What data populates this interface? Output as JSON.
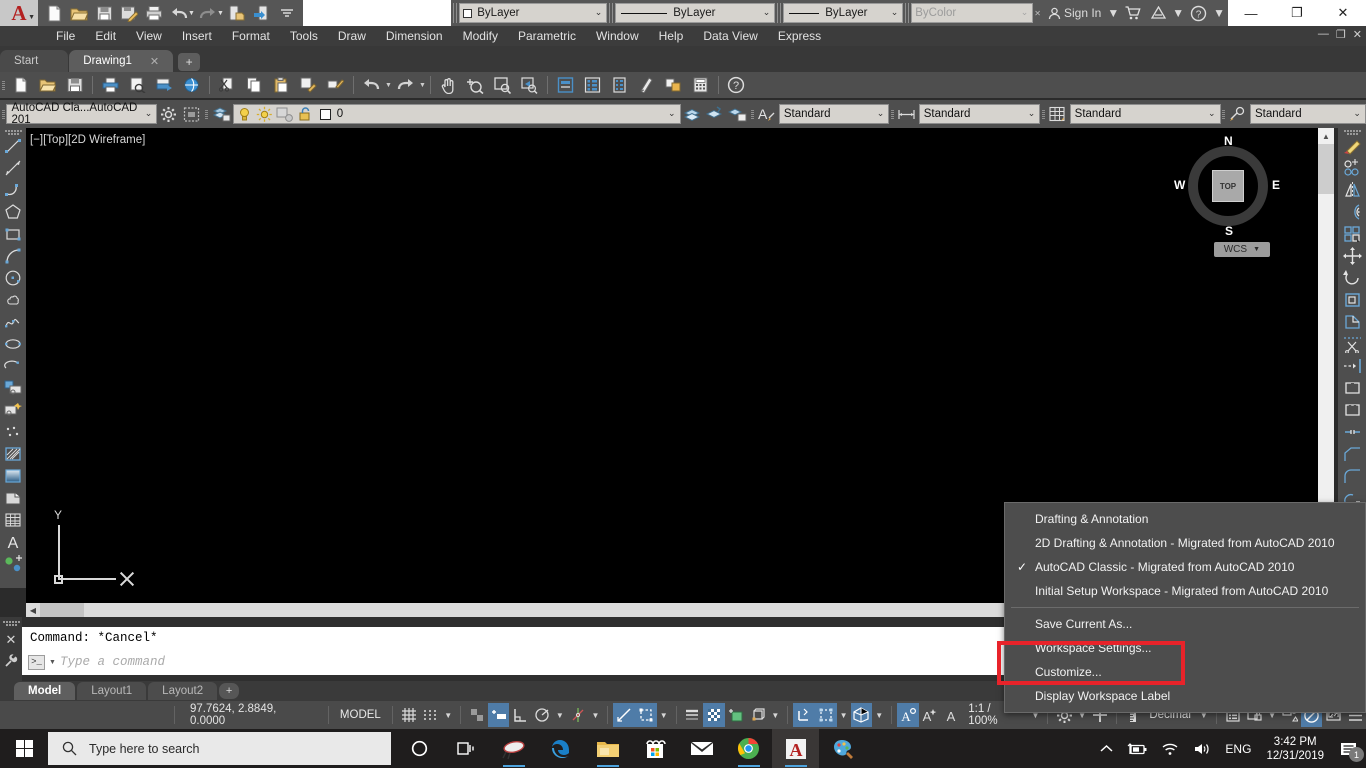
{
  "titlebar": {
    "app_name": "AutoCAD",
    "quick_access": [
      {
        "name": "new-file",
        "label": "New"
      },
      {
        "name": "open-file",
        "label": "Open"
      },
      {
        "name": "save-file",
        "label": "Save"
      },
      {
        "name": "save-as",
        "label": "Save As"
      },
      {
        "name": "plot",
        "label": "Plot"
      },
      {
        "name": "undo",
        "label": "Undo"
      },
      {
        "name": "redo",
        "label": "Redo"
      },
      {
        "name": "open-from-web",
        "label": "Open from Web & Mobile"
      },
      {
        "name": "save-to-web",
        "label": "Save to Web & Mobile"
      },
      {
        "name": "qat-more",
        "label": "Customize Quick Access Toolbar"
      }
    ],
    "properties": {
      "color": "ByLayer",
      "linetype": "ByLayer",
      "lineweight": "ByLayer",
      "plotstyle": "ByColor"
    },
    "sign_in": "Sign In",
    "window_buttons": {
      "minimize": "—",
      "maximize": "❐",
      "close": "✕"
    }
  },
  "menubar": {
    "items": [
      "File",
      "Edit",
      "View",
      "Insert",
      "Format",
      "Tools",
      "Draw",
      "Dimension",
      "Modify",
      "Parametric",
      "Window",
      "Help",
      "Data View",
      "Express"
    ],
    "window_buttons": [
      "—",
      "❐",
      "✕"
    ]
  },
  "filetabs": {
    "tabs": [
      {
        "label": "Start",
        "active": false,
        "closable": false
      },
      {
        "label": "Drawing1",
        "active": true,
        "closable": true,
        "close": "✕"
      }
    ],
    "new_tab": "+"
  },
  "toolbar_layers": {
    "workspace_value": "AutoCAD Cla...AutoCAD 201",
    "layer_value": "0",
    "text_style": "Standard",
    "dim_style": "Standard",
    "table_style": "Standard",
    "mleader_style": "Standard"
  },
  "canvas": {
    "viewport_label": "[−][Top][2D Wireframe]",
    "ucs_axis_label": "Y",
    "viewcube": {
      "top": "TOP",
      "n": "N",
      "s": "S",
      "e": "E",
      "w": "W"
    },
    "wcs_label": "WCS"
  },
  "command_line": {
    "history": "Command: *Cancel*",
    "placeholder": "Type a command",
    "prompt_glyph": ">_",
    "close_glyph": "✕",
    "settings_glyph": "🔧"
  },
  "layout_tabs": {
    "tabs": [
      "Model",
      "Layout1",
      "Layout2"
    ],
    "active": "Model",
    "new_layout": "+"
  },
  "status_bar": {
    "coordinates": "97.7624, 2.8849, 0.0000",
    "model_label": "MODEL",
    "scale": "1:1 / 100%",
    "units": "Decimal",
    "toggles": [
      {
        "name": "grid-display",
        "on": false
      },
      {
        "name": "snap-mode",
        "on": false
      },
      {
        "name": "infer-constraints",
        "on": false
      },
      {
        "name": "dynamic-input",
        "on": true
      },
      {
        "name": "ortho-mode",
        "on": false
      },
      {
        "name": "polar-tracking",
        "on": false
      },
      {
        "name": "isometric-drafting",
        "on": false
      },
      {
        "name": "object-snap-tracking",
        "on": true
      },
      {
        "name": "object-snap",
        "on": true
      },
      {
        "name": "lineweight-display",
        "on": false
      },
      {
        "name": "transparency-display",
        "on": true
      },
      {
        "name": "selection-cycling",
        "on": false
      },
      {
        "name": "3d-object-snap",
        "on": false
      },
      {
        "name": "dynamic-ucs",
        "on": true
      },
      {
        "name": "selection-filtering",
        "on": true
      },
      {
        "name": "gizmo",
        "on": true
      },
      {
        "name": "annotation-visibility",
        "on": true
      },
      {
        "name": "autoscale",
        "on": false
      },
      {
        "name": "annotation-scale",
        "on": false
      },
      {
        "name": "workspace-switching",
        "on": false
      },
      {
        "name": "annotation-monitor",
        "on": false
      },
      {
        "name": "units-selector",
        "on": false
      },
      {
        "name": "quick-properties",
        "on": false
      },
      {
        "name": "lock-ui",
        "on": false
      },
      {
        "name": "isolate-objects",
        "on": false
      },
      {
        "name": "graphics-performance",
        "on": true
      },
      {
        "name": "clean-screen",
        "on": false
      },
      {
        "name": "customization",
        "on": false
      }
    ]
  },
  "workspace_menu": {
    "items": [
      {
        "label": "Drafting & Annotation",
        "checked": false
      },
      {
        "label": "2D Drafting & Annotation - Migrated from AutoCAD 2010",
        "checked": false
      },
      {
        "label": "AutoCAD Classic - Migrated from AutoCAD 2010",
        "checked": true
      },
      {
        "label": "Initial Setup Workspace - Migrated from AutoCAD 2010",
        "checked": false
      }
    ],
    "actions": [
      {
        "label": "Save Current As..."
      },
      {
        "label": "Workspace Settings..."
      },
      {
        "label": "Customize...",
        "highlighted": true
      },
      {
        "label": "Display Workspace Label"
      }
    ],
    "check_glyph": "✓",
    "highlight_color": "#e8232a"
  },
  "taskbar": {
    "search_placeholder": "Type here to search",
    "language": "ENG",
    "time": "3:42 PM",
    "date": "12/31/2019",
    "notification_count": "1",
    "apps": [
      {
        "name": "task-view-icon"
      },
      {
        "name": "snip-sketch-icon"
      },
      {
        "name": "edge-icon"
      },
      {
        "name": "file-explorer-icon"
      },
      {
        "name": "microsoft-store-icon"
      },
      {
        "name": "mail-icon"
      },
      {
        "name": "chrome-icon"
      },
      {
        "name": "autocad-icon"
      },
      {
        "name": "paint-icon"
      }
    ]
  }
}
